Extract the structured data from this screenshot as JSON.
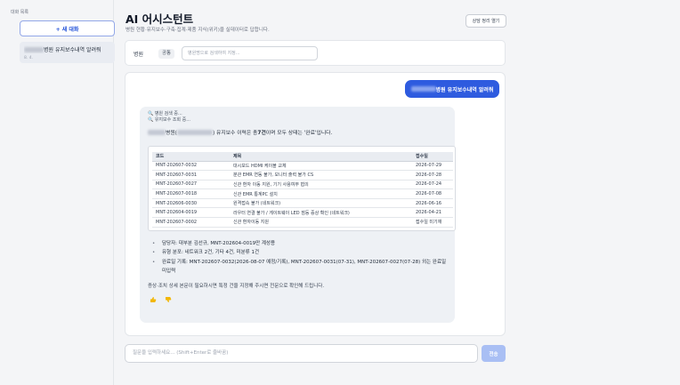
{
  "sidebar": {
    "title": "대화 목록",
    "new_chat_label": "+ 새 대화",
    "conversations": [
      {
        "title": "병원 유지보수내역 알려줘",
        "subtitle": "8. 4."
      }
    ]
  },
  "header": {
    "title": "AI 어시스턴트",
    "subtitle": "병원 현황·유지보수·구축·집계·제품 지식(위키)을 실데이터로 답합니다.",
    "consult_button": "상담 정리 열기"
  },
  "filter": {
    "label": "병원",
    "tag": "공통",
    "placeholder": "병원명으로 검색하여 지정..."
  },
  "chat": {
    "user_message": "병원 유지보수내역 알려줘",
    "status_lines": [
      "🔍 병원 검색 중...",
      "🔍 유지보수 조회 중..."
    ],
    "summary_prefix": "병원(",
    "summary_mid": ") 유지보수 이력은 총 ",
    "summary_count": "7건",
    "summary_suffix": "이며 모두 상태는 '완료'입니다.",
    "table": {
      "headers": [
        "코드",
        "제목",
        "접수일"
      ],
      "rows": [
        [
          "MNT-202607-0032",
          "대시보드 HDMI 케이블 교체",
          "2026-07-29"
        ],
        [
          "MNT-202607-0031",
          "분관 EMR 연동 불가, 모니터 출력 불가 CS",
          "2026-07-28"
        ],
        [
          "MNT-202607-0027",
          "신관 환자 이동 지원, 기기 사용여부 협의",
          "2026-07-24"
        ],
        [
          "MNT-202607-0018",
          "신관 EMR 통계PC 설치",
          "2026-07-08"
        ],
        [
          "MNT-202606-0030",
          "원격접속 불가 (네트워크)",
          "2026-06-16"
        ],
        [
          "MNT-202604-0019",
          "라우터 연결 불가 / 게이트웨이 LED 점등 증상 확인 (네트워크)",
          "2026-04-21"
        ],
        [
          "MNT-202607-0002",
          "신관 환자이동 지원",
          "접수일 미기재"
        ]
      ]
    },
    "bullets": [
      "담당자: 대부분 김선규, MNT-202604-0019만 계성용",
      "유형 분포: 네트워크 2건, 기타 4건, 미분류 1건",
      "완료일 기록: MNT-202607-0032(2026-08-07 예정/기록), MNT-202607-0031(07-31), MNT-202607-0027(07-28) 외는 완료일 미입력"
    ],
    "note": "증상·조치 상세 본문이 필요하시면 특정 건을 지정해 주시면 전문으로 확인해 드립니다."
  },
  "composer": {
    "placeholder": "질문을 입력하세요... (Shift+Enter로 줄바꿈)",
    "send_label": "전송"
  },
  "colors": {
    "accent": "#2e5bdf",
    "send_disabled": "#a9bff4"
  }
}
